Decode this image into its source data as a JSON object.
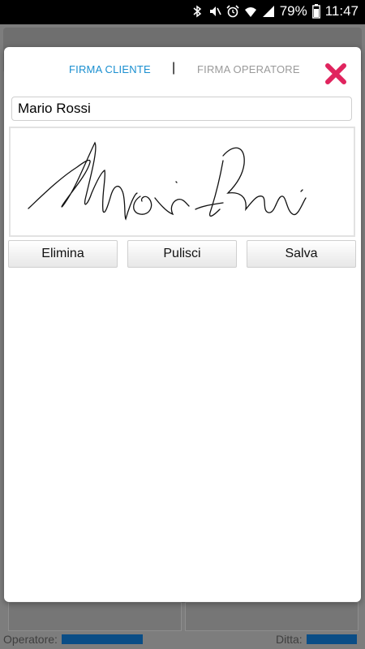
{
  "status_bar": {
    "battery": "79%",
    "time": "11:47",
    "icons": [
      "bluetooth-icon",
      "mute-icon",
      "alarm-icon",
      "wifi-icon",
      "signal-icon",
      "battery-icon"
    ]
  },
  "background": {
    "operator_label": "Operatore:",
    "company_label": "Ditta:"
  },
  "dialog": {
    "tabs": [
      {
        "label": "FIRMA CLIENTE",
        "active": true
      },
      {
        "label": "FIRMA OPERATORE",
        "active": false
      }
    ],
    "separator": "|",
    "close_icon": "close-icon",
    "name_input": {
      "value": "Mario Rossi",
      "placeholder": ""
    },
    "buttons": {
      "delete": "Elimina",
      "clear": "Pulisci",
      "save": "Salva"
    }
  },
  "colors": {
    "active_tab": "#1a8fd0",
    "inactive_tab": "#9a9a9a",
    "close_icon": "#e0245e",
    "overlay": "#7d7d7d",
    "footer_value": "#0a4d86"
  }
}
